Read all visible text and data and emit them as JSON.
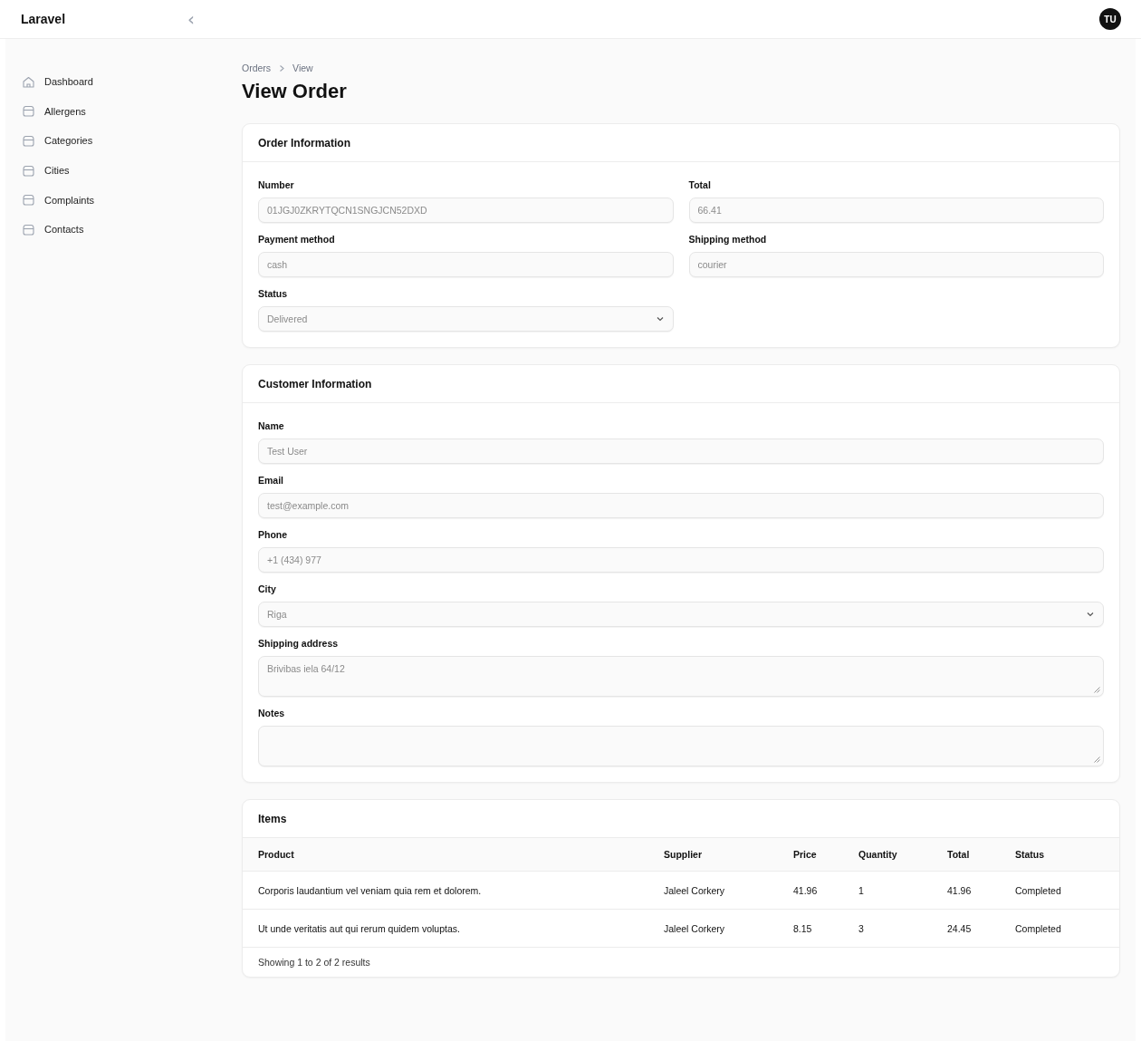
{
  "header": {
    "brand": "Laravel",
    "collapse_icon": "‹",
    "avatar": "TU"
  },
  "sidebar": {
    "items": [
      {
        "label": "Dashboard",
        "kind": "dashboard",
        "selected": false
      },
      {
        "label": "Allergens",
        "kind": "resource",
        "selected": false
      },
      {
        "label": "Categories",
        "kind": "resource",
        "selected": false
      },
      {
        "label": "Cities",
        "kind": "resource",
        "selected": false
      },
      {
        "label": "Complaints",
        "kind": "resource",
        "selected": false
      },
      {
        "label": "Contacts",
        "kind": "resource",
        "selected": false
      }
    ]
  },
  "breadcrumbs": [
    "Orders",
    "View"
  ],
  "page_title": "View Order",
  "sections": [
    {
      "title": "Order Information",
      "fields": [
        {
          "label": "Number",
          "value": "01JGJ0ZKRYTQCN1SNGJCN52DXD",
          "kind": "text"
        },
        {
          "label": "Total",
          "value": "66.41",
          "kind": "text"
        },
        {
          "label": "Payment method",
          "value": "cash",
          "kind": "text"
        },
        {
          "label": "Shipping method",
          "value": "courier",
          "kind": "text"
        },
        {
          "label": "Status",
          "value": "Delivered",
          "kind": "select"
        }
      ]
    },
    {
      "title": "Customer Information",
      "fields": [
        {
          "label": "Name",
          "value": "Test User",
          "kind": "text"
        },
        {
          "label": "Email",
          "value": "test@example.com",
          "kind": "text"
        },
        {
          "label": "Phone",
          "value": "+1 (434) 977",
          "kind": "text"
        },
        {
          "label": "City",
          "value": "Riga",
          "kind": "select"
        },
        {
          "label": "Shipping address",
          "value": "Brivibas iela 64/12",
          "kind": "textarea"
        },
        {
          "label": "Notes",
          "kind": "textarea"
        }
      ]
    }
  ],
  "items": {
    "title": "Items",
    "columns": [
      "Product",
      "Supplier",
      "Price",
      "Quantity",
      "Total",
      "Status"
    ],
    "rows": [
      [
        "Corporis laudantium vel veniam quia rem et dolorem.",
        "Jaleel Corkery",
        "41.96",
        "1",
        "41.96",
        "Completed"
      ],
      [
        "Ut unde veritatis aut qui rerum quidem voluptas.",
        "Jaleel Corkery",
        "8.15",
        "3",
        "24.45",
        "Completed"
      ]
    ],
    "footer": "Showing 1 to 2 of 2 results"
  }
}
